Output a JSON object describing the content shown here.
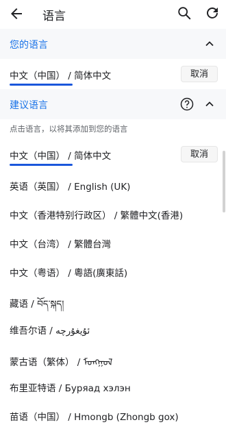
{
  "appbar": {
    "title": "语言"
  },
  "your_languages": {
    "header": "您的语言",
    "items": [
      {
        "label": "中文（中国） / 简体中文",
        "action": "取消"
      }
    ]
  },
  "suggested": {
    "header": "建议语言",
    "hint": "点击语言，以将其添加到您的语言",
    "items": [
      {
        "label": "中文（中国） / 简体中文",
        "action": "取消"
      },
      {
        "label": "英语（英国） / English (UK)"
      },
      {
        "label": "中文（香港特别行政区） / 繁體中文(香港)"
      },
      {
        "label": "中文（台湾） / 繁體台灣"
      },
      {
        "label": "中文（粤语） / 粵語(廣東話)"
      },
      {
        "label": "藏语 / བོད་སྐད།"
      },
      {
        "label": "维吾尔语 / ئۇيغۇرچە"
      },
      {
        "label": "蒙古语（繁体） / ᠮᠣᠩᠭᠣᠯ"
      },
      {
        "label": "布里亚特语 / Буряад хэлэн"
      },
      {
        "label": "苗语（中国） / Hmongb (Zhongb gox)"
      }
    ]
  },
  "colors": {
    "accent": "#1a73e8",
    "underline": "#1a56db"
  }
}
